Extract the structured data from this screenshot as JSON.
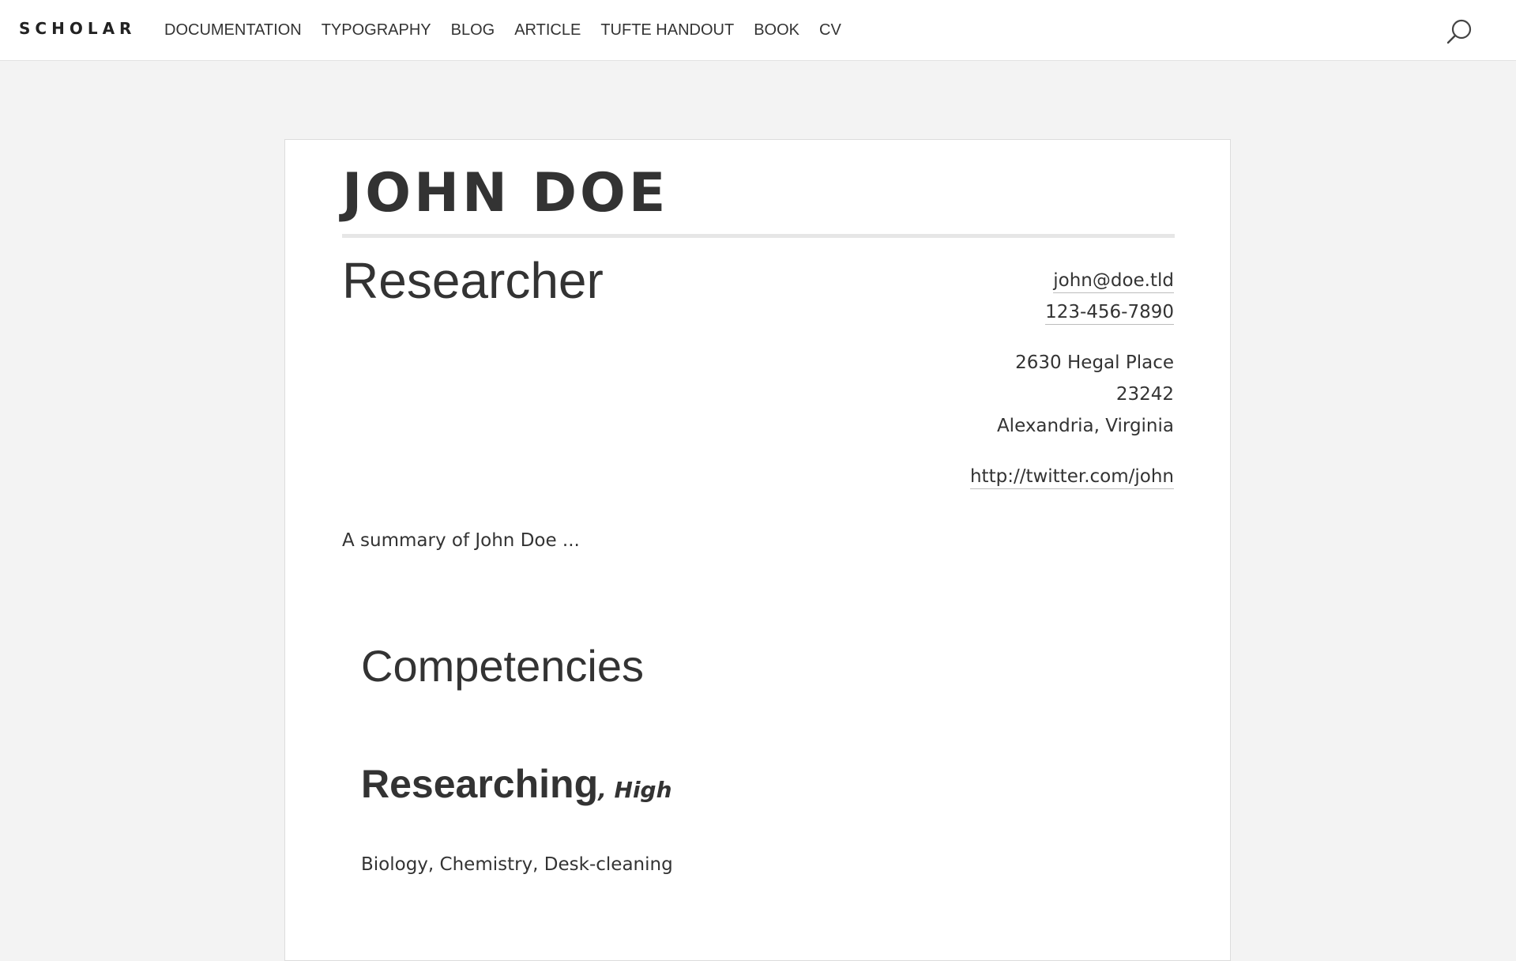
{
  "header": {
    "brand": "SCHOLAR",
    "nav": [
      {
        "label": "DOCUMENTATION"
      },
      {
        "label": "TYPOGRAPHY"
      },
      {
        "label": "BLOG"
      },
      {
        "label": "ARTICLE"
      },
      {
        "label": "TUFTE HANDOUT"
      },
      {
        "label": "BOOK"
      },
      {
        "label": "CV"
      }
    ],
    "search_icon": "search-icon"
  },
  "cv": {
    "name": "JOHN DOE",
    "role": "Researcher",
    "contact": {
      "email": "john@doe.tld",
      "phone": "123-456-7890",
      "street": "2630 Hegal Place",
      "postal_code": "23242",
      "city": "Alexandria, Virginia",
      "website": "http://twitter.com/john"
    },
    "summary": "A summary of John Doe ...",
    "sections": [
      {
        "title": "Competencies",
        "items": [
          {
            "name": "Researching",
            "level": ", High",
            "description": "Biology, Chemistry, Desk-cleaning"
          }
        ]
      }
    ]
  },
  "colors": {
    "page_background": "#f3f3f3",
    "card_background": "#ffffff",
    "text": "#333333",
    "rule": "#e6e6e6"
  }
}
